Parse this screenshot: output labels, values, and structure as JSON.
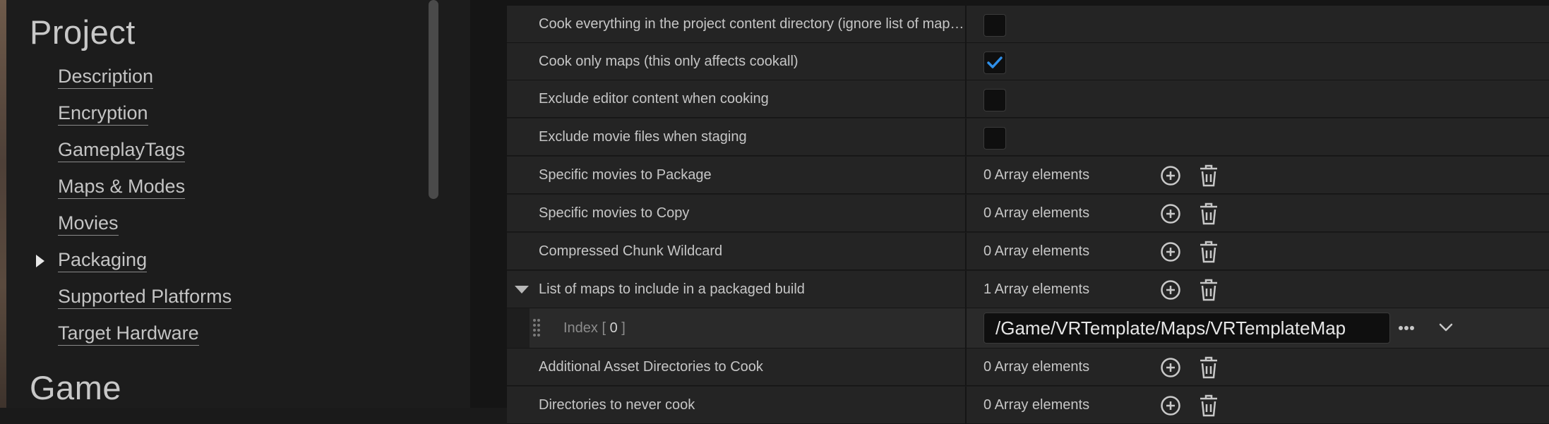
{
  "sidebar": {
    "section_project": "Project",
    "items": [
      {
        "label": "Description"
      },
      {
        "label": "Encryption"
      },
      {
        "label": "GameplayTags"
      },
      {
        "label": "Maps & Modes"
      },
      {
        "label": "Movies"
      },
      {
        "label": "Packaging"
      },
      {
        "label": "Supported Platforms"
      },
      {
        "label": "Target Hardware"
      }
    ],
    "section_game": "Game"
  },
  "properties": {
    "cook_everything": {
      "label": "Cook everything in the project content directory (ignore list of maps below)",
      "checked": false
    },
    "cook_only_maps": {
      "label": "Cook only maps (this only affects cookall)",
      "checked": true
    },
    "exclude_editor": {
      "label": "Exclude editor content when cooking",
      "checked": false
    },
    "exclude_movies": {
      "label": "Exclude movie files when staging",
      "checked": false
    },
    "movies_package": {
      "label": "Specific movies to Package",
      "value": "0 Array elements"
    },
    "movies_copy": {
      "label": "Specific movies to Copy",
      "value": "0 Array elements"
    },
    "chunk_wildcard": {
      "label": "Compressed Chunk Wildcard",
      "value": "0 Array elements"
    },
    "maps_list": {
      "label": "List of maps to include in a packaged build",
      "value": "1 Array elements"
    },
    "map_index": {
      "prefix": "Index [ ",
      "num": "0",
      "suffix": " ]",
      "path": "/Game/VRTemplate/Maps/VRTemplateMap"
    },
    "asset_dirs": {
      "label": "Additional Asset Directories to Cook",
      "value": "0 Array elements"
    },
    "never_cook": {
      "label": "Directories to never cook",
      "value": "0 Array elements"
    }
  },
  "colors": {
    "accent": "#2f8fe8",
    "text": "#c6c6c6",
    "row_bg": "#242424"
  },
  "icons": [
    "checkmark-icon",
    "add-circle-icon",
    "trash-icon",
    "grip-icon",
    "ellipsis-icon",
    "chevron-down-icon"
  ]
}
